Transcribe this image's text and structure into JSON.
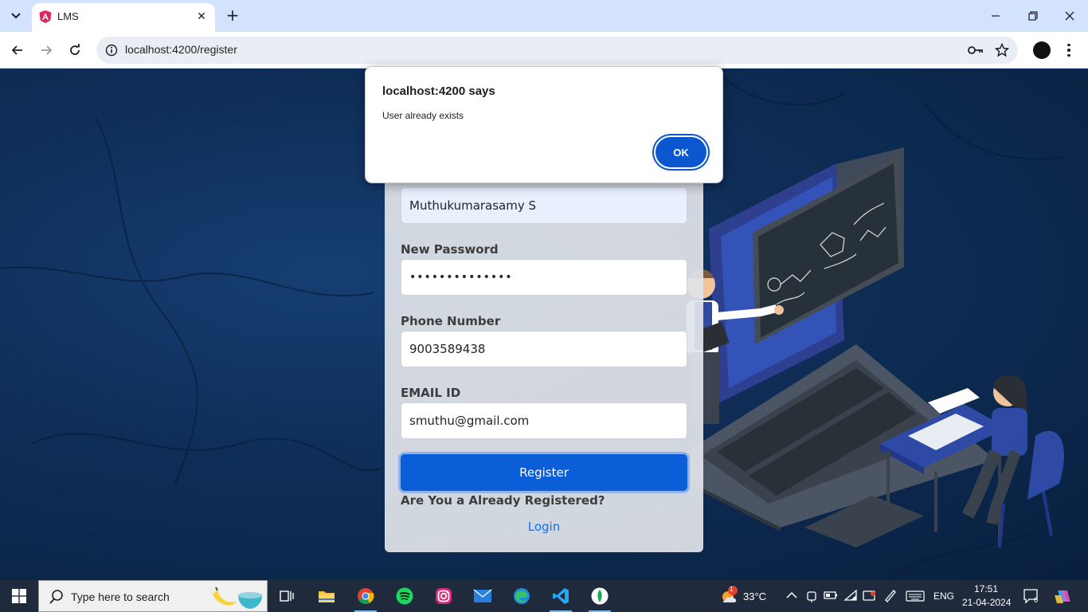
{
  "browser": {
    "tab_title": "LMS",
    "url": "localhost:4200/register"
  },
  "dialog": {
    "title": "localhost:4200 says",
    "message": "User already exists",
    "ok_label": "OK"
  },
  "form": {
    "name_value": "Muthukumarasamy S",
    "password_label": "New Password",
    "password_value": "••••••••••••••",
    "phone_label": "Phone Number",
    "phone_value": "9003589438",
    "email_label": "EMAIL ID",
    "email_value": "smuthu@gmail.com",
    "register_label": "Register",
    "already_text": "Are You a Already Registered?",
    "login_label": "Login"
  },
  "taskbar": {
    "search_placeholder": "Type here to search",
    "weather_temp": "33°C",
    "weather_badge": "1",
    "language": "ENG",
    "time": "17:51",
    "date": "21-04-2024",
    "notification_count": "6"
  },
  "colors": {
    "primary": "#0b5ed7",
    "dialog_ok": "#0b57d0",
    "link": "#0d6efd"
  }
}
